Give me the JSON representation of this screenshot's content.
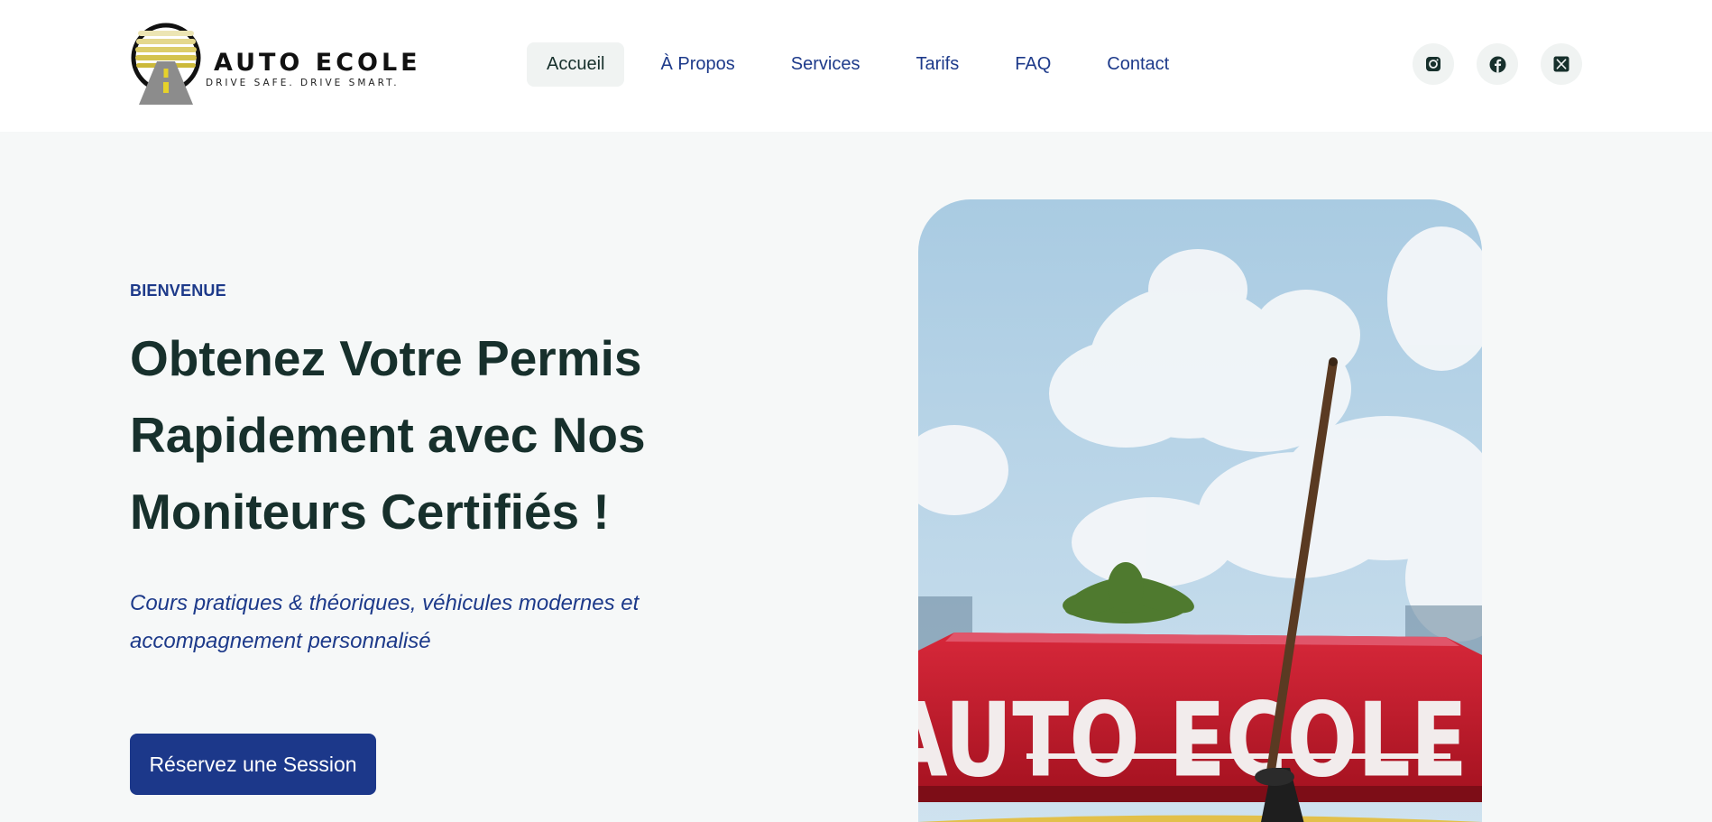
{
  "brand": {
    "name": "AUTO ECOLE",
    "tagline": "DRIVE SAFE. DRIVE SMART."
  },
  "nav": {
    "items": [
      {
        "label": "Accueil",
        "active": true
      },
      {
        "label": "À Propos",
        "active": false
      },
      {
        "label": "Services",
        "active": false
      },
      {
        "label": "Tarifs",
        "active": false
      },
      {
        "label": "FAQ",
        "active": false
      },
      {
        "label": "Contact",
        "active": false
      }
    ]
  },
  "socials": [
    {
      "icon": "instagram-icon"
    },
    {
      "icon": "facebook-icon"
    },
    {
      "icon": "x-twitter-icon"
    }
  ],
  "hero": {
    "eyebrow": "BIENVENUE",
    "headline": "Obtenez Votre Permis Rapidement avec Nos Moniteurs Certifiés !",
    "subtitle": "Cours pratiques & théoriques, véhicules modernes et accompagnement personnalisé",
    "cta_label": "Réservez une Session",
    "image": {
      "sign_text": "AUTO ECOLE"
    }
  },
  "colors": {
    "primary": "#1c388a",
    "heading": "#17302c",
    "background": "#f6f8f8",
    "sign_red": "#c8182a"
  }
}
